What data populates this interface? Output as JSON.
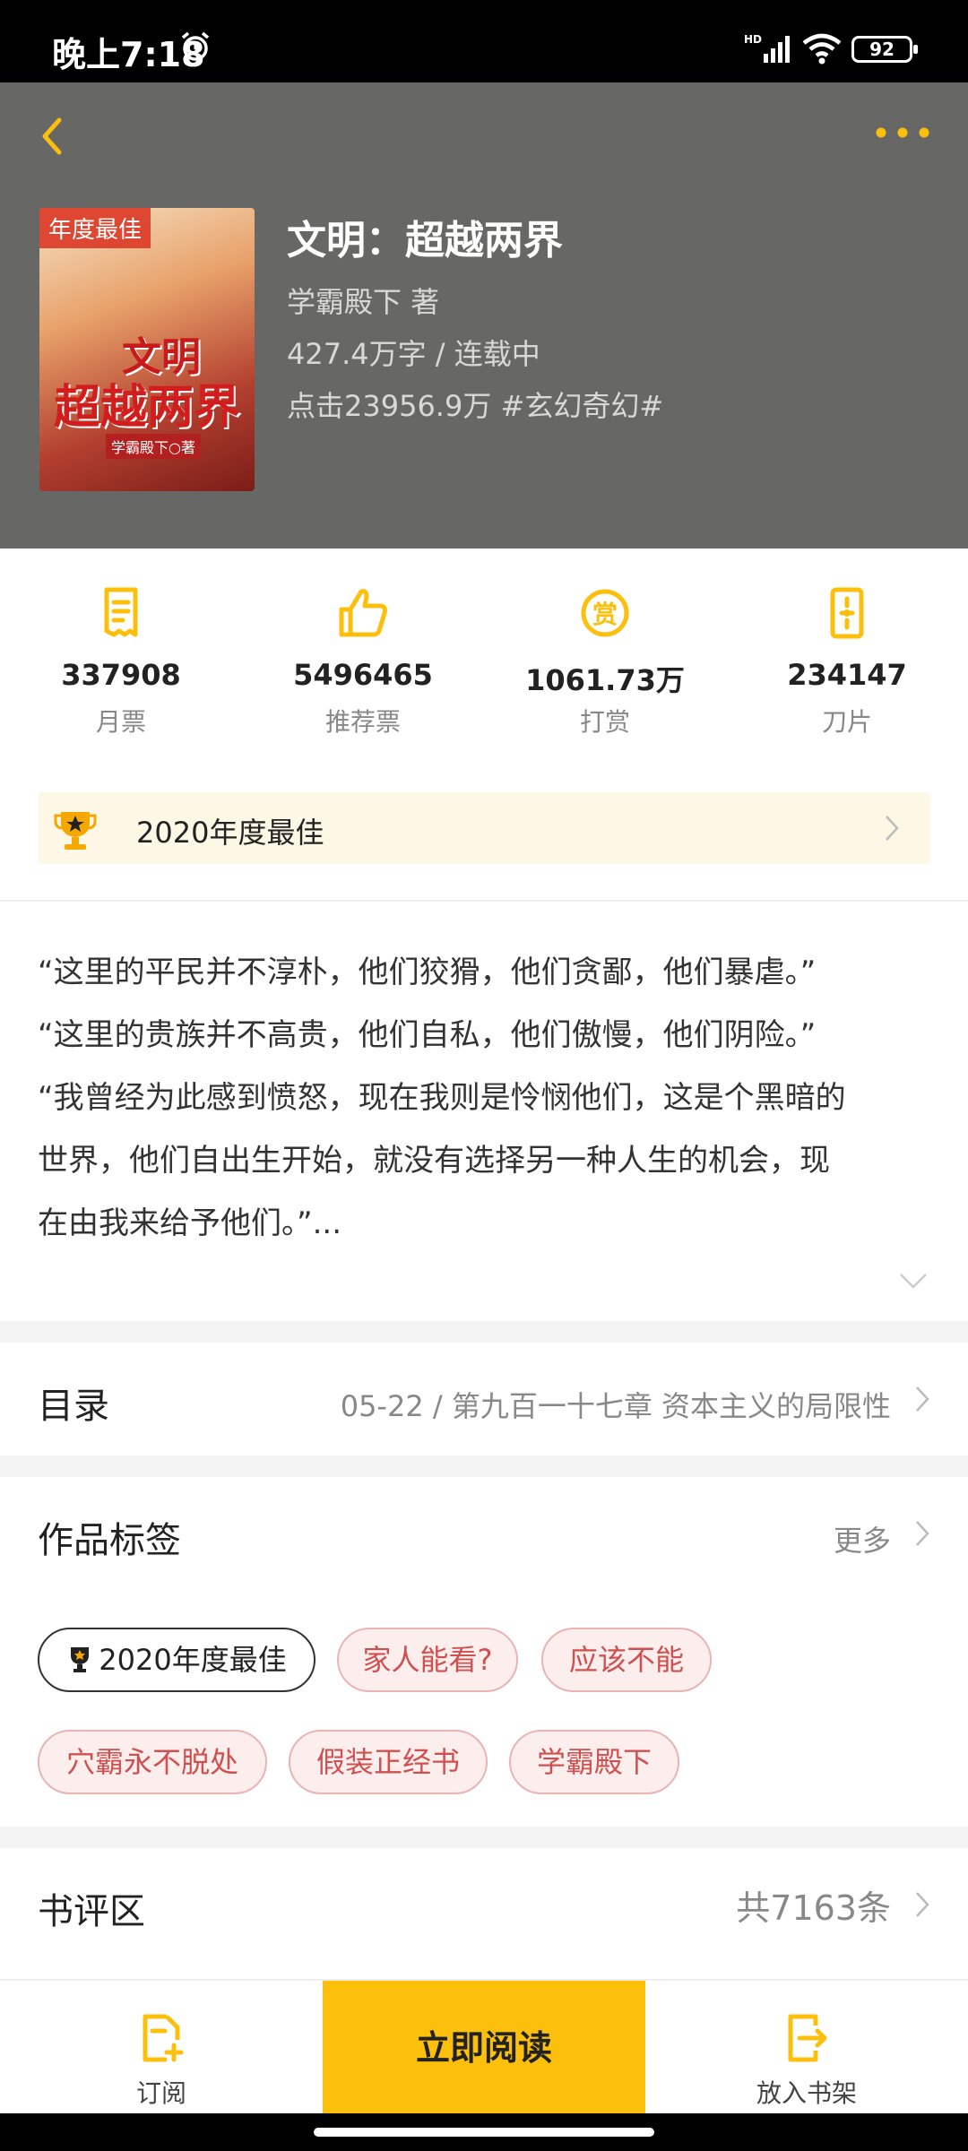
{
  "status_bar": {
    "time": "晚上7:18",
    "battery": "92",
    "icons": [
      "alarm-icon",
      "signal-icon",
      "wifi-icon",
      "battery-icon"
    ]
  },
  "header": {
    "back_icon": "chevron-left-icon",
    "more_icon": "more-dots-icon",
    "accent_color": "#fbbf0c",
    "background_color": "#676866"
  },
  "book": {
    "cover_badge": "年度最佳",
    "cover_title_line1": "文明",
    "cover_title_line2": "超越两界",
    "cover_author": "学霸殿下○著",
    "title": "文明：超越两界",
    "author": "学霸殿下  著",
    "length_status": "427.4万字 / 连载中",
    "clicks_genre": "点击23956.9万  #玄幻奇幻#"
  },
  "stats": [
    {
      "icon": "monthly-ticket-icon",
      "value": "337908",
      "label": "月票"
    },
    {
      "icon": "thumbs-up-icon",
      "value": "5496465",
      "label": "推荐票"
    },
    {
      "icon": "reward-icon",
      "value": "1061.73万",
      "label": "打赏"
    },
    {
      "icon": "blade-icon",
      "value": "234147",
      "label": "刀片"
    }
  ],
  "award": {
    "text": "2020年度最佳",
    "icon": "trophy-icon"
  },
  "description": [
    "“这里的平民并不淳朴，他们狡猾，他们贪鄙，他们暴虐。”",
    "“这里的贵族并不高贵，他们自私，他们傲慢，他们阴险。”",
    "“我曾经为此感到愤怒，现在我则是怜悯他们，这是个黑暗的",
    "世界，他们自出生开始，就没有选择另一种人生的机会，现",
    "在由我来给予他们。”..."
  ],
  "toc": {
    "title": "目录",
    "latest": "05-22 / 第九百一十七章 资本主义的局限性"
  },
  "tags_section": {
    "title": "作品标签",
    "more": "更多",
    "tags": [
      "2020年度最佳",
      "家人能看?",
      "应该不能",
      "穴霸永不脱处",
      "假装正经书",
      "学霸殿下"
    ]
  },
  "reviews": {
    "title": "书评区",
    "count": "共7163条"
  },
  "bottom_bar": {
    "subscribe": "订阅",
    "read_now": "立即阅读",
    "add_shelf": "放入书架"
  }
}
